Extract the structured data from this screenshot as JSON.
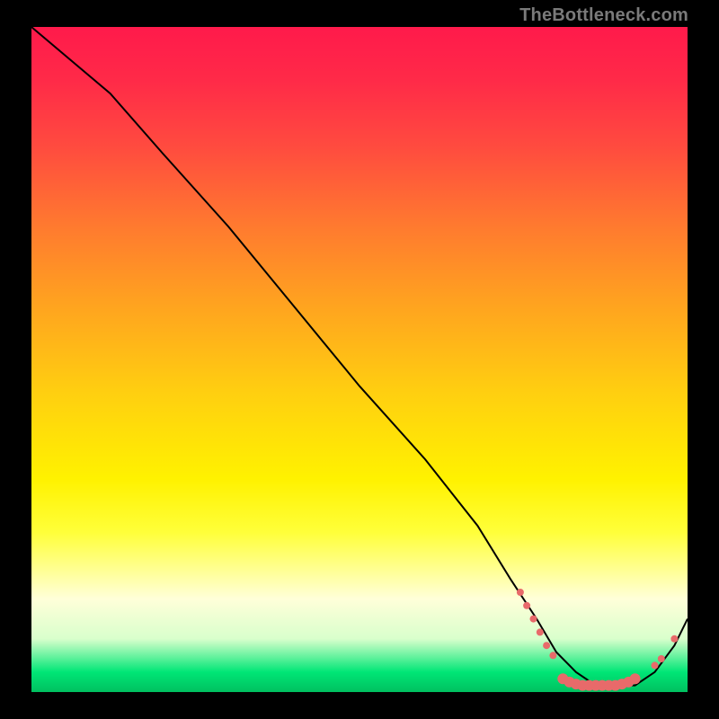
{
  "watermark": "TheBottleneck.com",
  "chart_data": {
    "type": "line",
    "title": "",
    "xlabel": "",
    "ylabel": "",
    "xlim": [
      0,
      100
    ],
    "ylim": [
      0,
      100
    ],
    "grid": false,
    "background_gradient": {
      "stops": [
        {
          "pos": 0,
          "color": "#ff1a4b"
        },
        {
          "pos": 18,
          "color": "#ff4b3f"
        },
        {
          "pos": 42,
          "color": "#ffa41f"
        },
        {
          "pos": 68,
          "color": "#fff200"
        },
        {
          "pos": 86,
          "color": "#ffffd9"
        },
        {
          "pos": 97,
          "color": "#00e676"
        },
        {
          "pos": 100,
          "color": "#00c060"
        }
      ]
    },
    "series": [
      {
        "name": "bottleneck-curve",
        "color": "#000000",
        "x": [
          0,
          6,
          12,
          20,
          30,
          40,
          50,
          60,
          68,
          73,
          77,
          80,
          83,
          86,
          89,
          92,
          95,
          98,
          100
        ],
        "values": [
          100,
          95,
          90,
          81,
          70,
          58,
          46,
          35,
          25,
          17,
          11,
          6,
          3,
          1,
          1,
          1,
          3,
          7,
          11
        ]
      }
    ],
    "markers": {
      "name": "highlight-points",
      "color": "#e86a6a",
      "radius_small": 4,
      "radius_large": 6,
      "points": [
        {
          "x": 74.5,
          "y": 15,
          "r": "small"
        },
        {
          "x": 75.5,
          "y": 13,
          "r": "small"
        },
        {
          "x": 76.5,
          "y": 11,
          "r": "small"
        },
        {
          "x": 77.5,
          "y": 9,
          "r": "small"
        },
        {
          "x": 78.5,
          "y": 7,
          "r": "small"
        },
        {
          "x": 79.5,
          "y": 5.5,
          "r": "small"
        },
        {
          "x": 81,
          "y": 2,
          "r": "large"
        },
        {
          "x": 82,
          "y": 1.5,
          "r": "large"
        },
        {
          "x": 83,
          "y": 1.2,
          "r": "large"
        },
        {
          "x": 84,
          "y": 1.0,
          "r": "large"
        },
        {
          "x": 85,
          "y": 1.0,
          "r": "large"
        },
        {
          "x": 86,
          "y": 1.0,
          "r": "large"
        },
        {
          "x": 87,
          "y": 1.0,
          "r": "large"
        },
        {
          "x": 88,
          "y": 1.0,
          "r": "large"
        },
        {
          "x": 89,
          "y": 1.0,
          "r": "large"
        },
        {
          "x": 90,
          "y": 1.2,
          "r": "large"
        },
        {
          "x": 91,
          "y": 1.5,
          "r": "large"
        },
        {
          "x": 92,
          "y": 2.0,
          "r": "large"
        },
        {
          "x": 95,
          "y": 4.0,
          "r": "small"
        },
        {
          "x": 96,
          "y": 5.0,
          "r": "small"
        },
        {
          "x": 98,
          "y": 8.0,
          "r": "small"
        }
      ]
    }
  }
}
